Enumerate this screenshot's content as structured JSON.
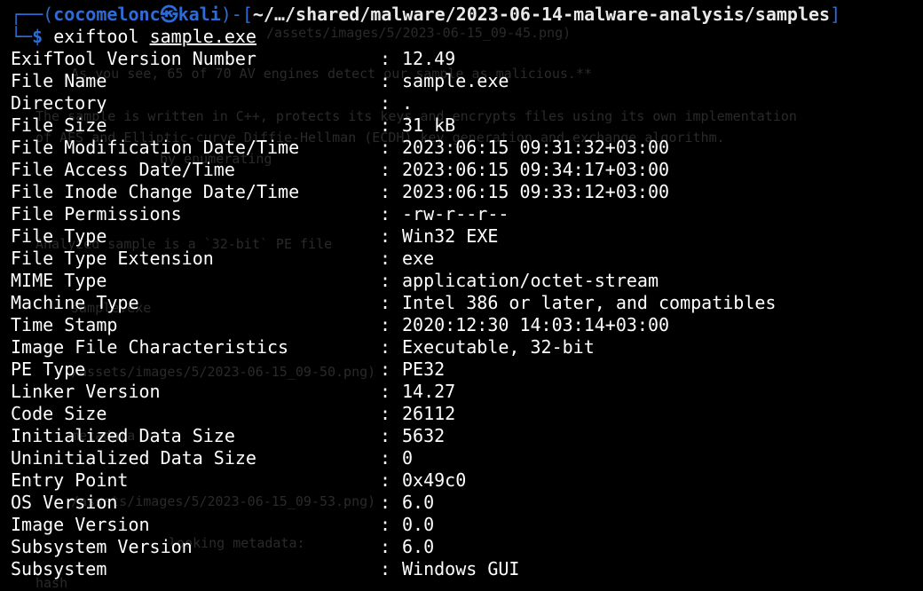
{
  "prompt": {
    "frame_top": "┌──(",
    "user": "cocomelonc㉿kali",
    "frame_mid": ")-[",
    "path": "~/…/shared/malware/2023-06-14-malware-analysis/samples",
    "frame_end": "]",
    "frame_bottom": "└─",
    "dollar": "$",
    "command": "exiftool",
    "argument": "sample.exe"
  },
  "separator": ":",
  "rows": [
    {
      "key": "ExifTool Version Number",
      "value": "12.49"
    },
    {
      "key": "File Name",
      "value": "sample.exe"
    },
    {
      "key": "Directory",
      "value": "."
    },
    {
      "key": "File Size",
      "value": "31 kB"
    },
    {
      "key": "File Modification Date/Time",
      "value": "2023:06:15 09:31:32+03:00"
    },
    {
      "key": "File Access Date/Time",
      "value": "2023:06:15 09:34:17+03:00"
    },
    {
      "key": "File Inode Change Date/Time",
      "value": "2023:06:15 09:33:12+03:00"
    },
    {
      "key": "File Permissions",
      "value": "-rw-r--r--"
    },
    {
      "key": "File Type",
      "value": "Win32 EXE"
    },
    {
      "key": "File Type Extension",
      "value": "exe"
    },
    {
      "key": "MIME Type",
      "value": "application/octet-stream"
    },
    {
      "key": "Machine Type",
      "value": "Intel 386 or later, and compatibles"
    },
    {
      "key": "Time Stamp",
      "value": "2020:12:30 14:03:14+03:00"
    },
    {
      "key": "Image File Characteristics",
      "value": "Executable, 32-bit"
    },
    {
      "key": "PE Type",
      "value": "PE32"
    },
    {
      "key": "Linker Version",
      "value": "14.27"
    },
    {
      "key": "Code Size",
      "value": "26112"
    },
    {
      "key": "Initialized Data Size",
      "value": "5632"
    },
    {
      "key": "Uninitialized Data Size",
      "value": "0"
    },
    {
      "key": "Entry Point",
      "value": "0x49c0"
    },
    {
      "key": "OS Version",
      "value": "6.0"
    },
    {
      "key": "Image Version",
      "value": "0.0"
    },
    {
      "key": "Subsystem Version",
      "value": "6.0"
    },
    {
      "key": "Subsystem",
      "value": "Windows GUI"
    }
  ],
  "background_ghost_text": [
    "/assets/images/5/2023-06-15_09-45.png)",
    "As you see, 65 of 70 AV engines detect our sample as malicious.**",
    "The sample is written in C++, protects its keys and encrypts files using its own implementation",
    "of AES and Elliptic-curve Diffie-Hellman (ECDH) key generation and exchange algorithm.",
    "by enumerating",
    "Analyzed sample is a `32-bit` PE file",
    "sample.exe",
    "/assets/images/5/2023-06-15_09-50.png)",
    "metadata",
    "/assets/images/5/2023-06-15_09-53.png)",
    "looking metadata:",
    "hash"
  ],
  "colors": {
    "background": "#000000",
    "prompt_accent": "#2f6bd4",
    "text": "#ffffff",
    "ghost": "#2a2a2a"
  }
}
